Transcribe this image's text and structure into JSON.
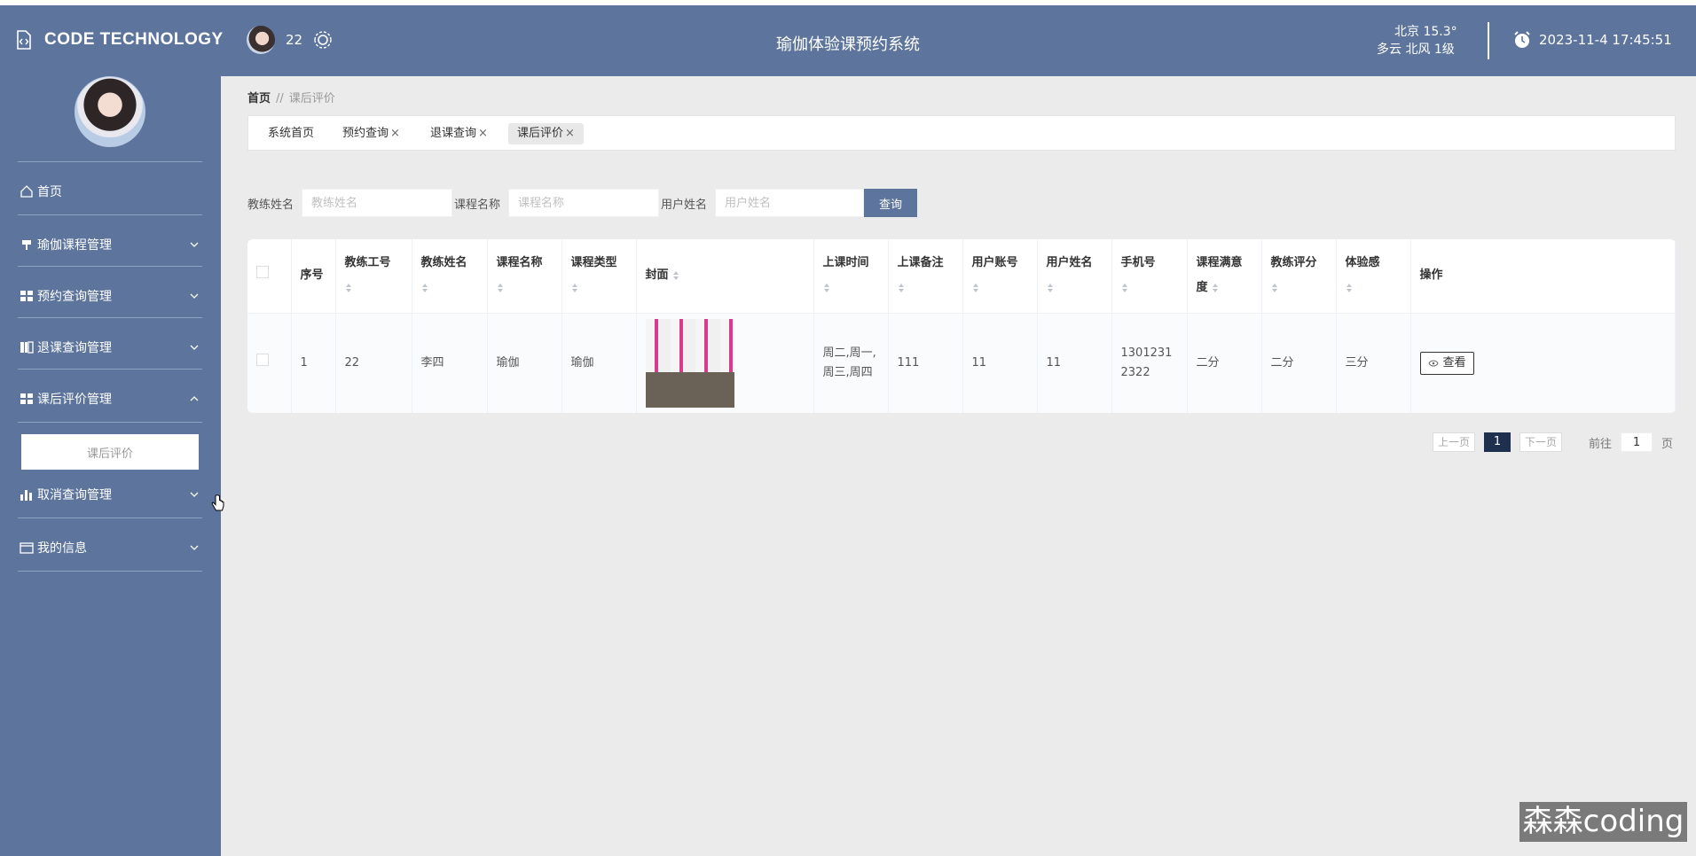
{
  "header": {
    "brand": "CODE TECHNOLOGY",
    "username": "22",
    "system_title": "瑜伽体验课预约系统",
    "weather_line1": "北京  15.3°",
    "weather_line2": "多云  北风  1级",
    "datetime": "2023-11-4 17:45:51"
  },
  "sidebar": {
    "items": [
      {
        "label": "首页",
        "icon": "home-icon"
      },
      {
        "label": "瑜伽课程管理",
        "icon": "bookmark-icon"
      },
      {
        "label": "预约查询管理",
        "icon": "grid-icon"
      },
      {
        "label": "退课查询管理",
        "icon": "book-icon"
      },
      {
        "label": "课后评价管理",
        "icon": "grid-icon"
      },
      {
        "label": "取消查询管理",
        "icon": "bar-chart-icon"
      },
      {
        "label": "我的信息",
        "icon": "card-icon"
      }
    ],
    "subitem": "课后评价"
  },
  "breadcrumb": {
    "home": "首页",
    "sep": "//",
    "current": "课后评价"
  },
  "tabs": [
    {
      "label": "系统首页"
    },
    {
      "label": "预约查询"
    },
    {
      "label": "退课查询"
    },
    {
      "label": "课后评价"
    }
  ],
  "search": {
    "coach_label": "教练姓名",
    "coach_placeholder": "教练姓名",
    "course_label": "课程名称",
    "course_placeholder": "课程名称",
    "user_label": "用户姓名",
    "user_placeholder": "用户姓名",
    "button": "查询"
  },
  "table": {
    "headers": [
      "序号",
      "教练工号",
      "教练姓名",
      "课程名称",
      "课程类型",
      "封面",
      "上课时间",
      "上课备注",
      "用户账号",
      "用户姓名",
      "手机号",
      "课程满意度",
      "教练评分",
      "体验感",
      "操作"
    ],
    "rows": [
      {
        "index": "1",
        "coach_id": "22",
        "coach_name": "李四",
        "course_name": "瑜伽",
        "course_type": "瑜伽",
        "time": "周二,周一,周三,周四",
        "note": "111",
        "account": "11",
        "user_name": "11",
        "phone": "13012312322",
        "satisfaction": "二分",
        "coach_score": "二分",
        "experience": "三分",
        "action": "查看"
      }
    ]
  },
  "pager": {
    "prev": "上一页",
    "current": "1",
    "next": "下一页",
    "goto": "前往",
    "page_value": "1",
    "page_unit": "页"
  },
  "watermark": "森森coding",
  "colors": {
    "primary": "#5d759c",
    "pager_active": "#1f2f4e"
  }
}
